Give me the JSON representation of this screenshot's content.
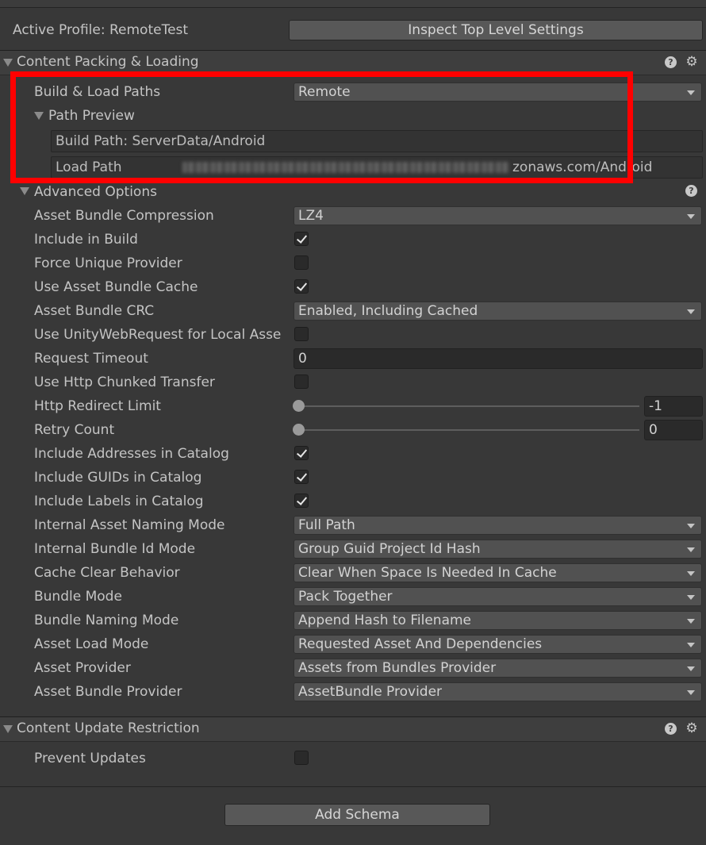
{
  "profile": {
    "label": "Active Profile: RemoteTest",
    "inspect_button": "Inspect Top Level Settings"
  },
  "content_packing": {
    "title": "Content Packing & Loading",
    "build_load_paths": {
      "label": "Build & Load Paths",
      "value": "Remote"
    },
    "path_preview": {
      "title": "Path Preview",
      "build_path": "Build Path: ServerData/Android",
      "load_path_label": "Load Path",
      "load_path_suffix": "zonaws.com/Android"
    },
    "advanced_options": {
      "title": "Advanced Options",
      "asset_bundle_compression": {
        "label": "Asset Bundle Compression",
        "value": "LZ4"
      },
      "include_in_build": {
        "label": "Include in Build",
        "checked": true
      },
      "force_unique_provider": {
        "label": "Force Unique Provider",
        "checked": false
      },
      "use_asset_bundle_cache": {
        "label": "Use Asset Bundle Cache",
        "checked": true
      },
      "asset_bundle_crc": {
        "label": "Asset Bundle CRC",
        "value": "Enabled, Including Cached"
      },
      "use_unitywebrequest": {
        "label": "Use UnityWebRequest for Local Asse",
        "checked": false
      },
      "request_timeout": {
        "label": "Request Timeout",
        "value": "0"
      },
      "use_http_chunked": {
        "label": "Use Http Chunked Transfer",
        "checked": false
      },
      "http_redirect_limit": {
        "label": "Http Redirect Limit",
        "value": "-1"
      },
      "retry_count": {
        "label": "Retry Count",
        "value": "0"
      },
      "include_addresses": {
        "label": "Include Addresses in Catalog",
        "checked": true
      },
      "include_guids": {
        "label": "Include GUIDs in Catalog",
        "checked": true
      },
      "include_labels": {
        "label": "Include Labels in Catalog",
        "checked": true
      },
      "internal_asset_naming": {
        "label": "Internal Asset Naming Mode",
        "value": "Full Path"
      },
      "internal_bundle_id": {
        "label": "Internal Bundle Id Mode",
        "value": "Group Guid Project Id Hash"
      },
      "cache_clear": {
        "label": "Cache Clear Behavior",
        "value": "Clear When Space Is Needed In Cache"
      },
      "bundle_mode": {
        "label": "Bundle Mode",
        "value": "Pack Together"
      },
      "bundle_naming": {
        "label": "Bundle Naming Mode",
        "value": "Append Hash to Filename"
      },
      "asset_load_mode": {
        "label": "Asset Load Mode",
        "value": "Requested Asset And Dependencies"
      },
      "asset_provider": {
        "label": "Asset Provider",
        "value": "Assets from Bundles Provider"
      },
      "asset_bundle_provider": {
        "label": "Asset Bundle Provider",
        "value": "AssetBundle Provider"
      }
    }
  },
  "content_update": {
    "title": "Content Update Restriction",
    "prevent_updates": {
      "label": "Prevent Updates",
      "checked": false
    }
  },
  "add_schema_button": "Add Schema",
  "icons": {
    "help": "?",
    "gear": "⚙"
  },
  "colors": {
    "background": "#383838",
    "highlight": "#ff0000"
  }
}
